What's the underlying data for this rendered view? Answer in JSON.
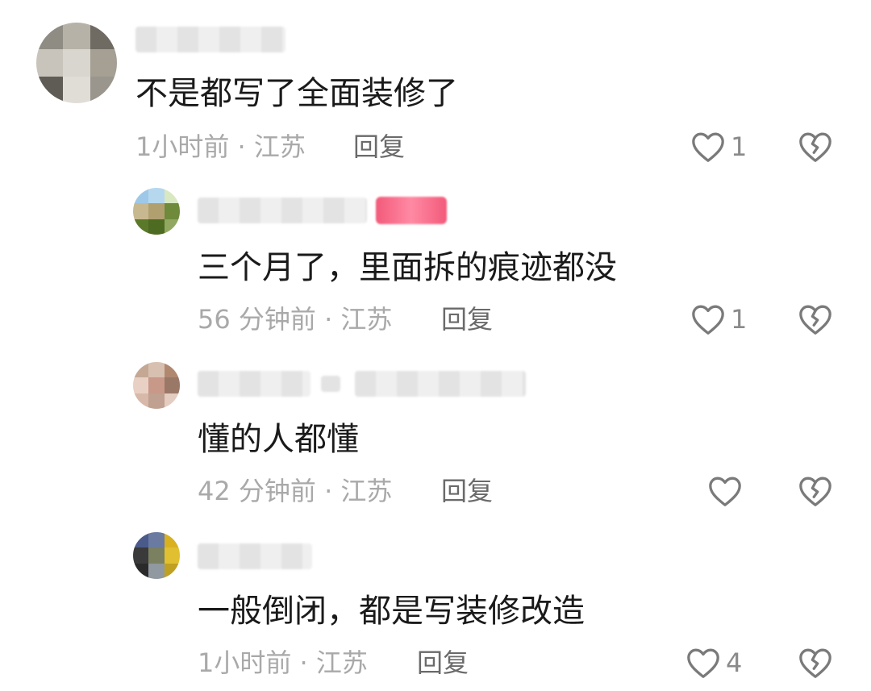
{
  "comments": [
    {
      "text": "不是都写了全面装修了",
      "meta": "1小时前 · 江苏",
      "reply_label": "回复",
      "likes": "1",
      "avatar_colors": [
        "#8f8c84",
        "#b7b2a8",
        "#6f6a62",
        "#c9c4bb",
        "#d9d6d0",
        "#a59f94",
        "#5f5b55",
        "#e0ddd7",
        "#9a968e"
      ]
    },
    {
      "text": "三个月了，里面拆的痕迹都没",
      "meta": "56 分钟前 · 江苏",
      "reply_label": "回复",
      "likes": "1",
      "avatar_colors": [
        "#9ec8e8",
        "#b6d8ef",
        "#d8e8c0",
        "#c8b890",
        "#b0a070",
        "#6f8a3a",
        "#5a7a2a",
        "#4e6b22",
        "#90a860"
      ]
    },
    {
      "text": "懂的人都懂",
      "meta": "42 分钟前 · 江苏",
      "reply_label": "回复",
      "likes": "",
      "avatar_colors": [
        "#c4a894",
        "#d8c0b0",
        "#b08870",
        "#e8d0c4",
        "#c89888",
        "#9a7868",
        "#d8b8a8",
        "#c0a090",
        "#e4ccc0"
      ]
    },
    {
      "text": "一般倒闭，都是写装修改造",
      "meta": "1小时前 · 江苏",
      "reply_label": "回复",
      "likes": "4",
      "avatar_colors": [
        "#4a5a8a",
        "#6a7aa0",
        "#d8b020",
        "#3a3a3a",
        "#7a8060",
        "#e0c030",
        "#2a2a2a",
        "#9098a0",
        "#c0a020"
      ]
    }
  ],
  "colors": {
    "text": "#1a1a1a",
    "meta": "#a9a9a9",
    "reply": "#6a6a6a",
    "icon": "#7a7a7a",
    "badge": "#f25a7a"
  },
  "icons": [
    "heart-outline-icon",
    "broken-heart-icon"
  ]
}
